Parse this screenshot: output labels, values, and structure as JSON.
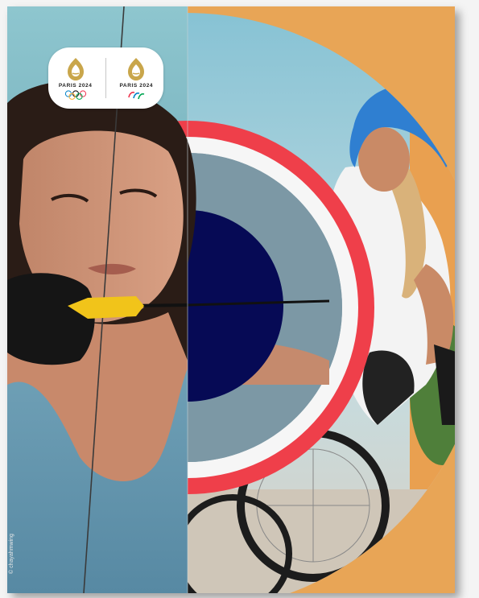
{
  "logos": [
    {
      "name": "olympic",
      "text": "PARIS 2024",
      "emblem": "olympic-rings-icon"
    },
    {
      "name": "paralympic",
      "text": "PARIS 2024",
      "emblem": "agitos-icon"
    }
  ],
  "photo_credit": "© chayahmwing",
  "colors": {
    "red_ring": "#ef3f4a",
    "navy_disc": "#060a55",
    "white_ring": "#ffffff",
    "gold": "#c9a64b"
  }
}
